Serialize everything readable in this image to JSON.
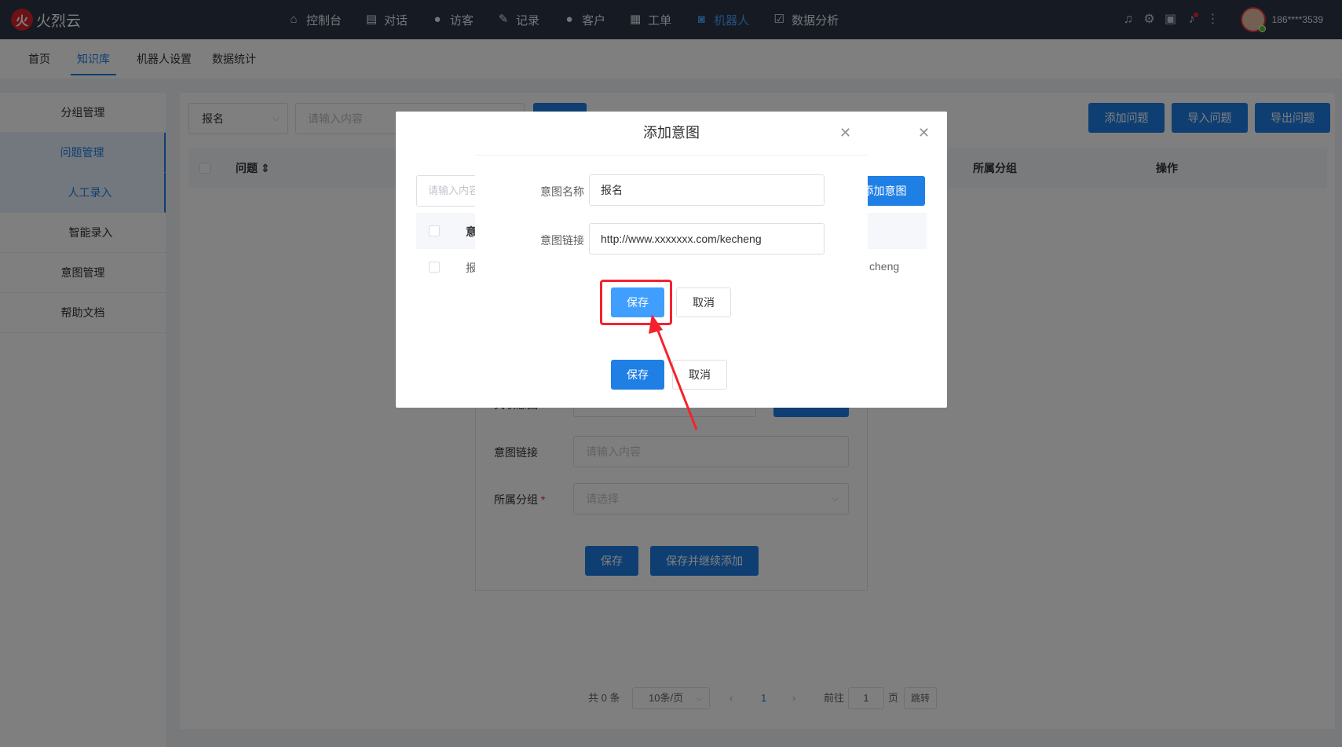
{
  "brand": {
    "logo_char": "火",
    "name": "火烈云"
  },
  "nav": [
    {
      "label": "控制台",
      "icon": "home-icon"
    },
    {
      "label": "对话",
      "icon": "chat-icon"
    },
    {
      "label": "访客",
      "icon": "visitor-icon"
    },
    {
      "label": "记录",
      "icon": "record-icon"
    },
    {
      "label": "客户",
      "icon": "customer-icon"
    },
    {
      "label": "工单",
      "icon": "ticket-icon"
    },
    {
      "label": "机器人",
      "icon": "robot-icon",
      "active": true
    },
    {
      "label": "数据分析",
      "icon": "analytics-icon"
    }
  ],
  "user": {
    "name": "186****3539"
  },
  "subnav": [
    "首页",
    "知识库",
    "机器人设置",
    "数据统计"
  ],
  "sidebar": [
    "分组管理",
    "问题管理",
    "人工录入",
    "智能录入",
    "意图管理",
    "帮助文档"
  ],
  "filter": {
    "select_value": "报名",
    "placeholder": "请输入内容"
  },
  "toolbar": {
    "add_question": "添加问题",
    "import_question": "导入问题",
    "export_question": "导出问题"
  },
  "table": {
    "headers": [
      "问题",
      "所属分组",
      "操作"
    ]
  },
  "pager": {
    "total": "共 0 条",
    "page_size": "10条/页",
    "current_page": "1",
    "goto_label": "前往",
    "goto_value": "1",
    "page_unit": "页",
    "jump": "跳转"
  },
  "form": {
    "intent_label": "关联意图",
    "choose_intent_button": "选择意图",
    "intent_link_label": "意图链接",
    "intent_link_placeholder": "请输入内容",
    "group_label": "所属分组",
    "group_required": "*",
    "group_placeholder": "请选择",
    "save": "保存",
    "save_continue": "保存并继续添加"
  },
  "intent_dialog": {
    "search_placeholder": "请输入内容",
    "add_intent_button": "添加意图",
    "col_intent": "意",
    "row_intent": "报",
    "row_link_tail": "cheng",
    "save": "保存",
    "cancel": "取消"
  },
  "add_intent_dialog": {
    "title": "添加意图",
    "name_label": "意图名称",
    "name_value": "报名",
    "link_label": "意图链接",
    "link_value": "http://www.xxxxxxx.com/kecheng",
    "save": "保存",
    "cancel": "取消"
  },
  "colors": {
    "primary": "#1f7fe5",
    "highlight": "#f5222d",
    "topbar": "#2b3446"
  }
}
